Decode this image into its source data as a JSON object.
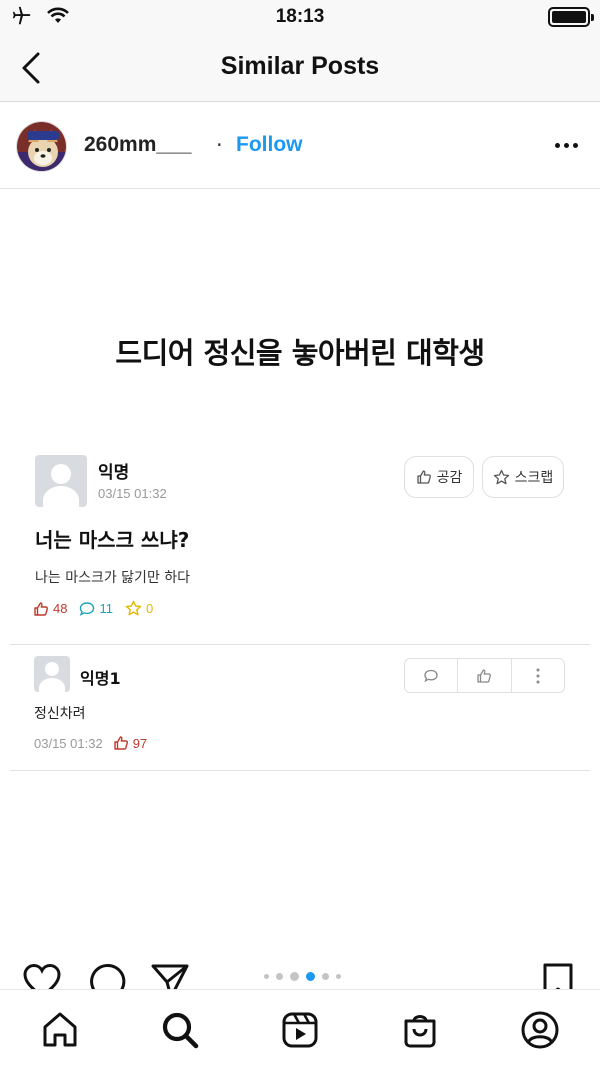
{
  "status_bar": {
    "time": "18:13"
  },
  "nav": {
    "title": "Similar Posts"
  },
  "post_header": {
    "username": "260mm___",
    "separator": "·",
    "follow_label": "Follow"
  },
  "content": {
    "headline": "드디어 정신을 놓아버린 대학생",
    "card": {
      "author": "익명",
      "date": "03/15 01:32",
      "like_button_label": "공감",
      "scrap_button_label": "스크랩",
      "title": "너는 마스크 쓰냐?",
      "body": "나는 마스크가 닳기만 하다",
      "likes": "48",
      "comments": "11",
      "scraps": "0"
    },
    "comment": {
      "author": "익명1",
      "body": "정신차려",
      "date": "03/15 01:32",
      "likes": "97"
    }
  },
  "carousel": {
    "count": 6,
    "active": 2
  },
  "colors": {
    "follow": "#1d98f0",
    "likes": "#c0392b",
    "comments": "#1aa5b8",
    "scraps": "#e6b800"
  },
  "icons": [
    "airplane-icon",
    "wifi-icon",
    "battery-icon",
    "back-chevron-icon",
    "more-icon",
    "heart-icon",
    "comment-icon",
    "share-icon",
    "bookmark-icon",
    "home-icon",
    "search-icon",
    "reels-icon",
    "shop-icon",
    "profile-icon"
  ]
}
